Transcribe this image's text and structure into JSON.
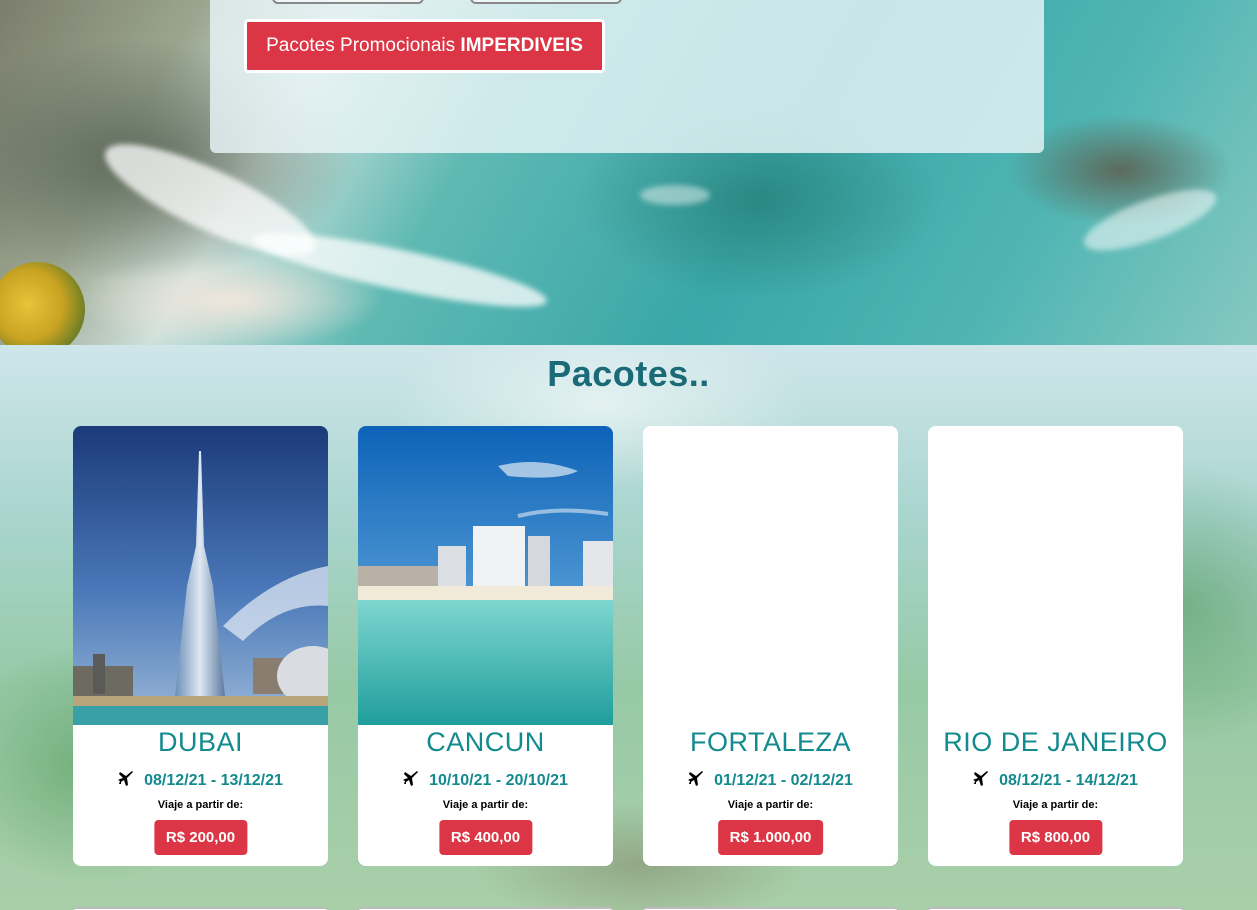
{
  "hero": {
    "promo_button": {
      "text": "Pacotes Promocionais ",
      "strong": "IMPERDIVEIS"
    }
  },
  "packages": {
    "title": "Pacotes..",
    "items": [
      {
        "city": "DUBAI",
        "dates": "08/12/21 - 13/12/21",
        "from_label": "Viaje a partir de:",
        "price": "R$ 200,00",
        "image": "dubai-burj-khalifa-photo"
      },
      {
        "city": "CANCUN",
        "dates": "10/10/21 - 20/10/21",
        "from_label": "Viaje a partir de:",
        "price": "R$ 400,00",
        "image": "cancun-beach-photo"
      },
      {
        "city": "FORTALEZA",
        "dates": "01/12/21 - 02/12/21",
        "from_label": "Viaje a partir de:",
        "price": "R$ 1.000,00",
        "image": "none"
      },
      {
        "city": "RIO DE JANEIRO",
        "dates": "08/12/21 - 14/12/21",
        "from_label": "Viaje a partir de:",
        "price": "R$ 800,00",
        "image": "none"
      }
    ]
  },
  "colors": {
    "accent_red": "#dc3545",
    "teal_text": "#138a8e",
    "title_blue": "#1a6a78"
  }
}
